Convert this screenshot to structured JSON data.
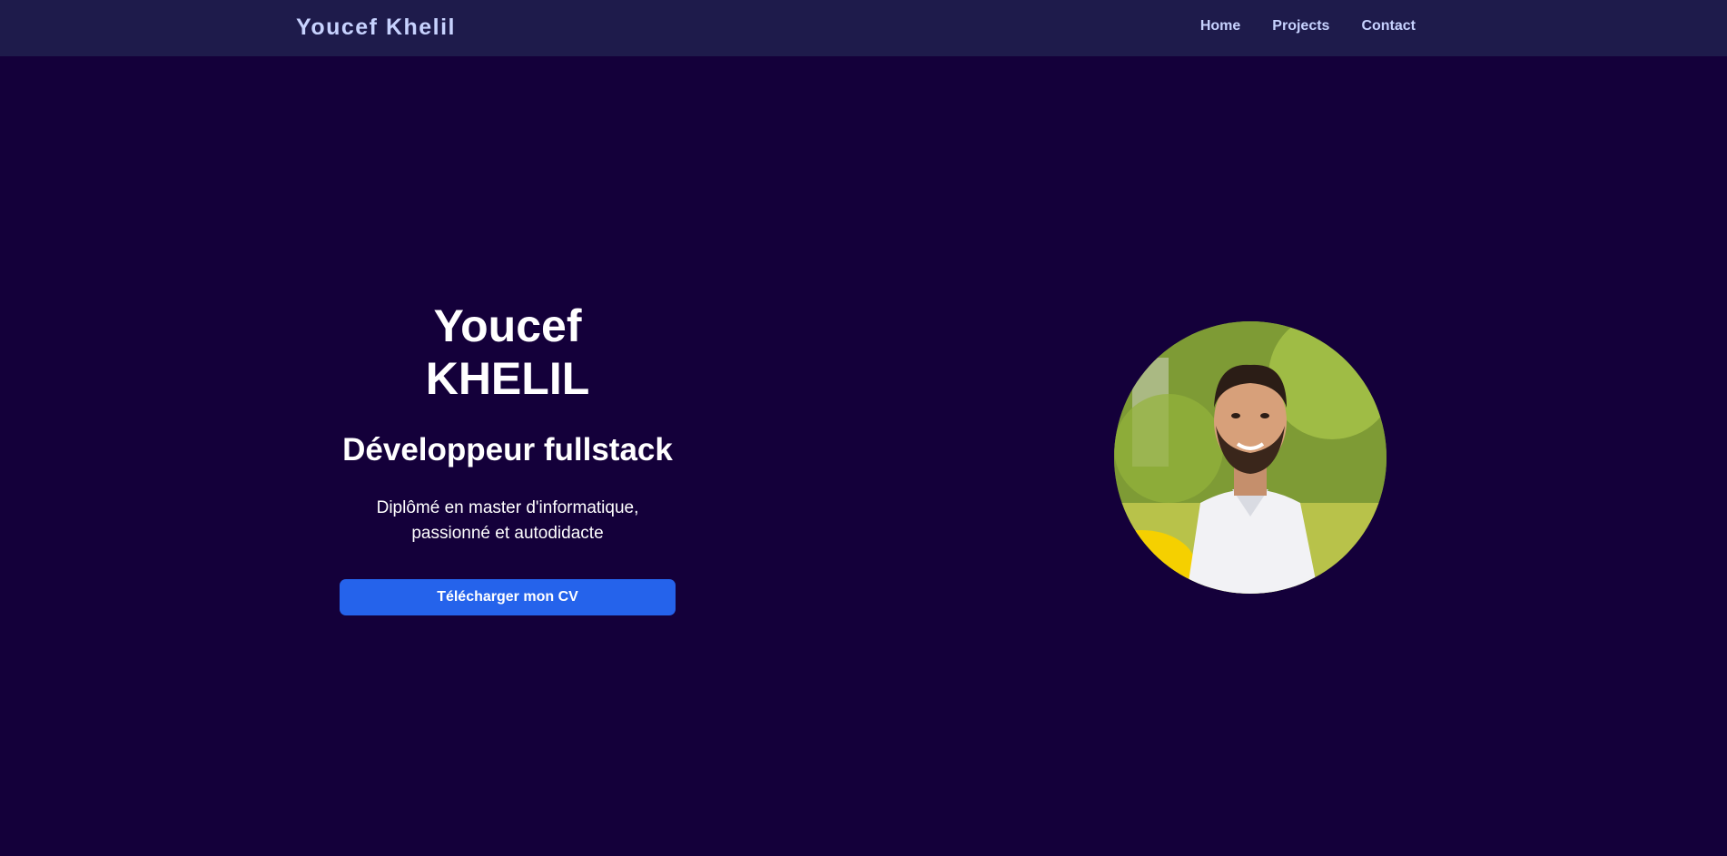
{
  "header": {
    "brand": "Youcef Khelil",
    "nav": [
      {
        "label": "Home"
      },
      {
        "label": "Projects"
      },
      {
        "label": "Contact"
      }
    ]
  },
  "hero": {
    "name": "Youcef KHELIL",
    "role": "Développeur fullstack",
    "description": "Diplômé en master d'informatique, passionné et autodidacte",
    "cv_button": "Télécharger mon CV"
  },
  "colors": {
    "background": "#14003a",
    "navbar": "#1e1b4b",
    "nav_text": "#c7d2fe",
    "button": "#2563eb"
  },
  "icons": {
    "avatar": "profile-photo"
  }
}
